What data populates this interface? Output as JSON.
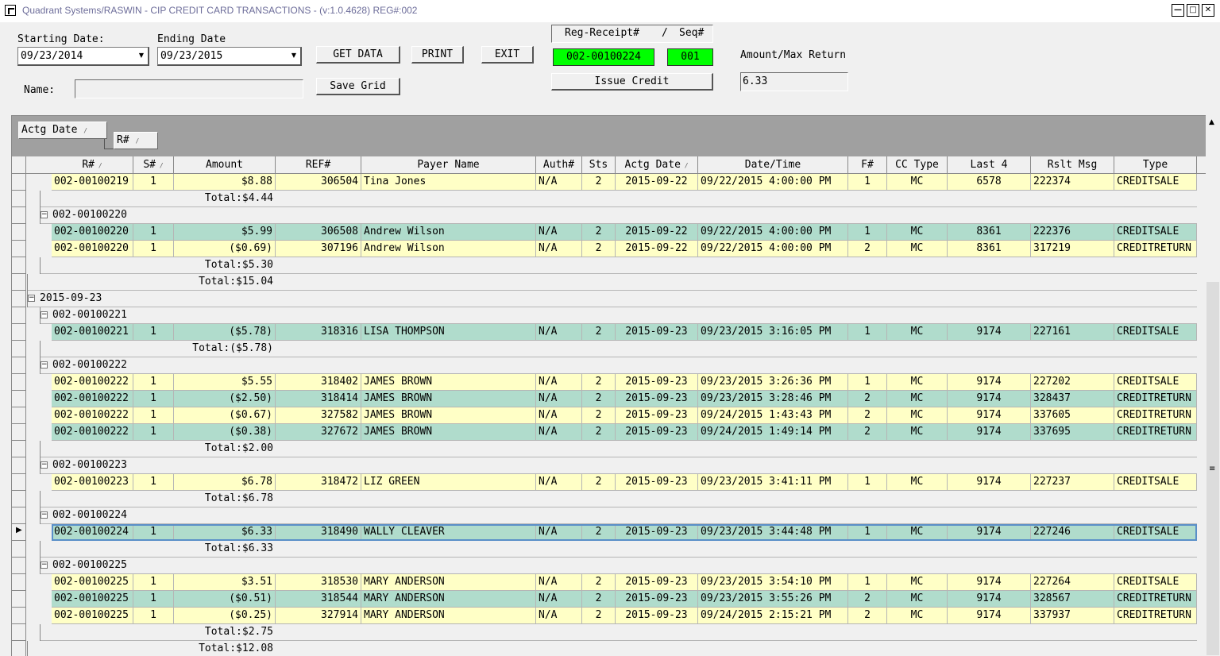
{
  "window": {
    "title": "Quadrant Systems/RASWIN - CIP CREDIT CARD TRANSACTIONS - (v:1.0.4628) REG#:002",
    "min_icon": "minimize-icon",
    "max_icon": "maximize-icon",
    "close_icon": "close-icon"
  },
  "filters": {
    "start_label": "Starting Date:",
    "start_value": "09/23/2014",
    "end_label": "Ending Date",
    "end_value": "09/23/2015",
    "name_label": "Name:",
    "name_value": ""
  },
  "buttons": {
    "get_data": "GET DATA",
    "print": "PRINT",
    "exit": "EXIT",
    "save_grid": "Save Grid",
    "issue_credit": "Issue Credit"
  },
  "receipt": {
    "header_reg": "Reg-Receipt#",
    "header_sep": "/",
    "header_seq": "Seq#",
    "reg_value": "002-00100224",
    "seq_value": "001",
    "amount_label": "Amount/Max Return",
    "amount_value": "6.33"
  },
  "grid": {
    "group_by": [
      "Actg Date",
      "R#"
    ],
    "columns": [
      "R#",
      "S#",
      "Amount",
      "REF#",
      "Payer Name",
      "Auth#",
      "Sts",
      "Actg Date",
      "Date/Time",
      "F#",
      "CC Type",
      "Last 4",
      "Rslt Msg",
      "Type"
    ],
    "sorted_columns": [
      "R#",
      "S#",
      "Actg Date"
    ],
    "rows": [
      {
        "kind": "data",
        "color": "yellow",
        "cells": [
          "002-00100219",
          "1",
          "$8.88",
          "306504",
          "Tina Jones",
          "N/A",
          "2",
          "2015-09-22",
          "09/22/2015 4:00:00 PM",
          "1",
          "MC",
          "6578",
          "222374",
          "CREDITSALE"
        ]
      },
      {
        "kind": "total",
        "level": 2,
        "text": "Total:$4.44"
      },
      {
        "kind": "group",
        "level": 2,
        "text": "002-00100220"
      },
      {
        "kind": "data",
        "color": "teal",
        "cells": [
          "002-00100220",
          "1",
          "$5.99",
          "306508",
          "Andrew Wilson",
          "N/A",
          "2",
          "2015-09-22",
          "09/22/2015 4:00:00 PM",
          "1",
          "MC",
          "8361",
          "222376",
          "CREDITSALE"
        ]
      },
      {
        "kind": "data",
        "color": "yellow",
        "cells": [
          "002-00100220",
          "1",
          "($0.69)",
          "307196",
          "Andrew Wilson",
          "N/A",
          "2",
          "2015-09-22",
          "09/22/2015 4:00:00 PM",
          "2",
          "MC",
          "8361",
          "317219",
          "CREDITRETURN"
        ]
      },
      {
        "kind": "total",
        "level": 2,
        "text": "Total:$5.30"
      },
      {
        "kind": "total",
        "level": 1,
        "text": "Total:$15.04"
      },
      {
        "kind": "group",
        "level": 1,
        "text": "2015-09-23"
      },
      {
        "kind": "group",
        "level": 2,
        "text": "002-00100221"
      },
      {
        "kind": "data",
        "color": "teal",
        "cells": [
          "002-00100221",
          "1",
          "($5.78)",
          "318316",
          "LISA THOMPSON",
          "N/A",
          "2",
          "2015-09-23",
          "09/23/2015 3:16:05 PM",
          "1",
          "MC",
          "9174",
          "227161",
          "CREDITSALE"
        ]
      },
      {
        "kind": "total",
        "level": 2,
        "text": "Total:($5.78)"
      },
      {
        "kind": "group",
        "level": 2,
        "text": "002-00100222"
      },
      {
        "kind": "data",
        "color": "yellow",
        "cells": [
          "002-00100222",
          "1",
          "$5.55",
          "318402",
          "JAMES BROWN",
          "N/A",
          "2",
          "2015-09-23",
          "09/23/2015 3:26:36 PM",
          "1",
          "MC",
          "9174",
          "227202",
          "CREDITSALE"
        ]
      },
      {
        "kind": "data",
        "color": "teal",
        "cells": [
          "002-00100222",
          "1",
          "($2.50)",
          "318414",
          "JAMES BROWN",
          "N/A",
          "2",
          "2015-09-23",
          "09/23/2015 3:28:46 PM",
          "2",
          "MC",
          "9174",
          "328437",
          "CREDITRETURN"
        ]
      },
      {
        "kind": "data",
        "color": "yellow",
        "cells": [
          "002-00100222",
          "1",
          "($0.67)",
          "327582",
          "JAMES BROWN",
          "N/A",
          "2",
          "2015-09-23",
          "09/24/2015 1:43:43 PM",
          "2",
          "MC",
          "9174",
          "337605",
          "CREDITRETURN"
        ]
      },
      {
        "kind": "data",
        "color": "teal",
        "cells": [
          "002-00100222",
          "1",
          "($0.38)",
          "327672",
          "JAMES BROWN",
          "N/A",
          "2",
          "2015-09-23",
          "09/24/2015 1:49:14 PM",
          "2",
          "MC",
          "9174",
          "337695",
          "CREDITRETURN"
        ]
      },
      {
        "kind": "total",
        "level": 2,
        "text": "Total:$2.00"
      },
      {
        "kind": "group",
        "level": 2,
        "text": "002-00100223"
      },
      {
        "kind": "data",
        "color": "yellow",
        "cells": [
          "002-00100223",
          "1",
          "$6.78",
          "318472",
          "LIZ GREEN",
          "N/A",
          "2",
          "2015-09-23",
          "09/23/2015 3:41:11 PM",
          "1",
          "MC",
          "9174",
          "227237",
          "CREDITSALE"
        ]
      },
      {
        "kind": "total",
        "level": 2,
        "text": "Total:$6.78"
      },
      {
        "kind": "group",
        "level": 2,
        "text": "002-00100224"
      },
      {
        "kind": "data",
        "color": "teal",
        "selected": true,
        "cells": [
          "002-00100224",
          "1",
          "$6.33",
          "318490",
          "WALLY CLEAVER",
          "N/A",
          "2",
          "2015-09-23",
          "09/23/2015 3:44:48 PM",
          "1",
          "MC",
          "9174",
          "227246",
          "CREDITSALE"
        ]
      },
      {
        "kind": "total",
        "level": 2,
        "text": "Total:$6.33"
      },
      {
        "kind": "group",
        "level": 2,
        "text": "002-00100225"
      },
      {
        "kind": "data",
        "color": "yellow",
        "cells": [
          "002-00100225",
          "1",
          "$3.51",
          "318530",
          "MARY ANDERSON",
          "N/A",
          "2",
          "2015-09-23",
          "09/23/2015 3:54:10 PM",
          "1",
          "MC",
          "9174",
          "227264",
          "CREDITSALE"
        ]
      },
      {
        "kind": "data",
        "color": "teal",
        "cells": [
          "002-00100225",
          "1",
          "($0.51)",
          "318544",
          "MARY ANDERSON",
          "N/A",
          "2",
          "2015-09-23",
          "09/23/2015 3:55:26 PM",
          "2",
          "MC",
          "9174",
          "328567",
          "CREDITRETURN"
        ]
      },
      {
        "kind": "data",
        "color": "yellow",
        "cells": [
          "002-00100225",
          "1",
          "($0.25)",
          "327914",
          "MARY ANDERSON",
          "N/A",
          "2",
          "2015-09-23",
          "09/24/2015 2:15:21 PM",
          "2",
          "MC",
          "9174",
          "337937",
          "CREDITRETURN"
        ]
      },
      {
        "kind": "total",
        "level": 2,
        "text": "Total:$2.75"
      },
      {
        "kind": "total",
        "level": 1,
        "text": "Total:$12.08"
      }
    ]
  },
  "colors": {
    "row_yellow": "#ffffc6",
    "row_teal": "#b0dccc",
    "highlight_green": "#00ff00"
  }
}
